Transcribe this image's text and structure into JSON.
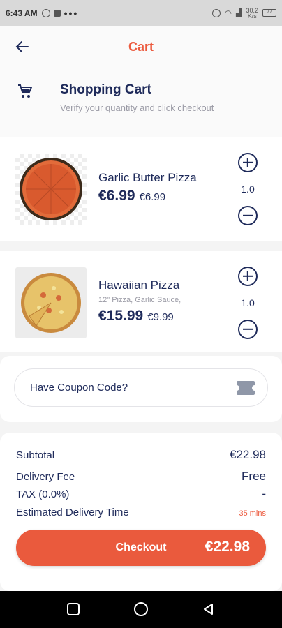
{
  "status_bar": {
    "time": "6:43 AM",
    "dots": "•••",
    "net_speed": "30.2\nK/s",
    "battery": "77"
  },
  "header": {
    "title": "Cart"
  },
  "section": {
    "title": "Shopping Cart",
    "subtitle": "Verify your quantity and click checkout"
  },
  "items": [
    {
      "name": "Garlic Butter Pizza",
      "description": "",
      "price": "€6.99",
      "old_price": "€6.99",
      "quantity": "1.0"
    },
    {
      "name": "Hawaiian Pizza",
      "description": "12\" Pizza, Garlic Sauce,",
      "price": "€15.99",
      "old_price": "€9.99",
      "quantity": "1.0"
    }
  ],
  "coupon": {
    "label": "Have Coupon Code?"
  },
  "summary": {
    "subtotal_label": "Subtotal",
    "subtotal_value": "€22.98",
    "delivery_label": "Delivery Fee",
    "delivery_value": "Free",
    "tax_label": "TAX (0.0%)",
    "tax_value": "-",
    "time_label": "Estimated Delivery Time",
    "time_value": "35 mins"
  },
  "checkout": {
    "label": "Checkout",
    "total": "€22.98"
  },
  "colors": {
    "accent": "#ea5a3d",
    "navy": "#1e2a5a"
  }
}
